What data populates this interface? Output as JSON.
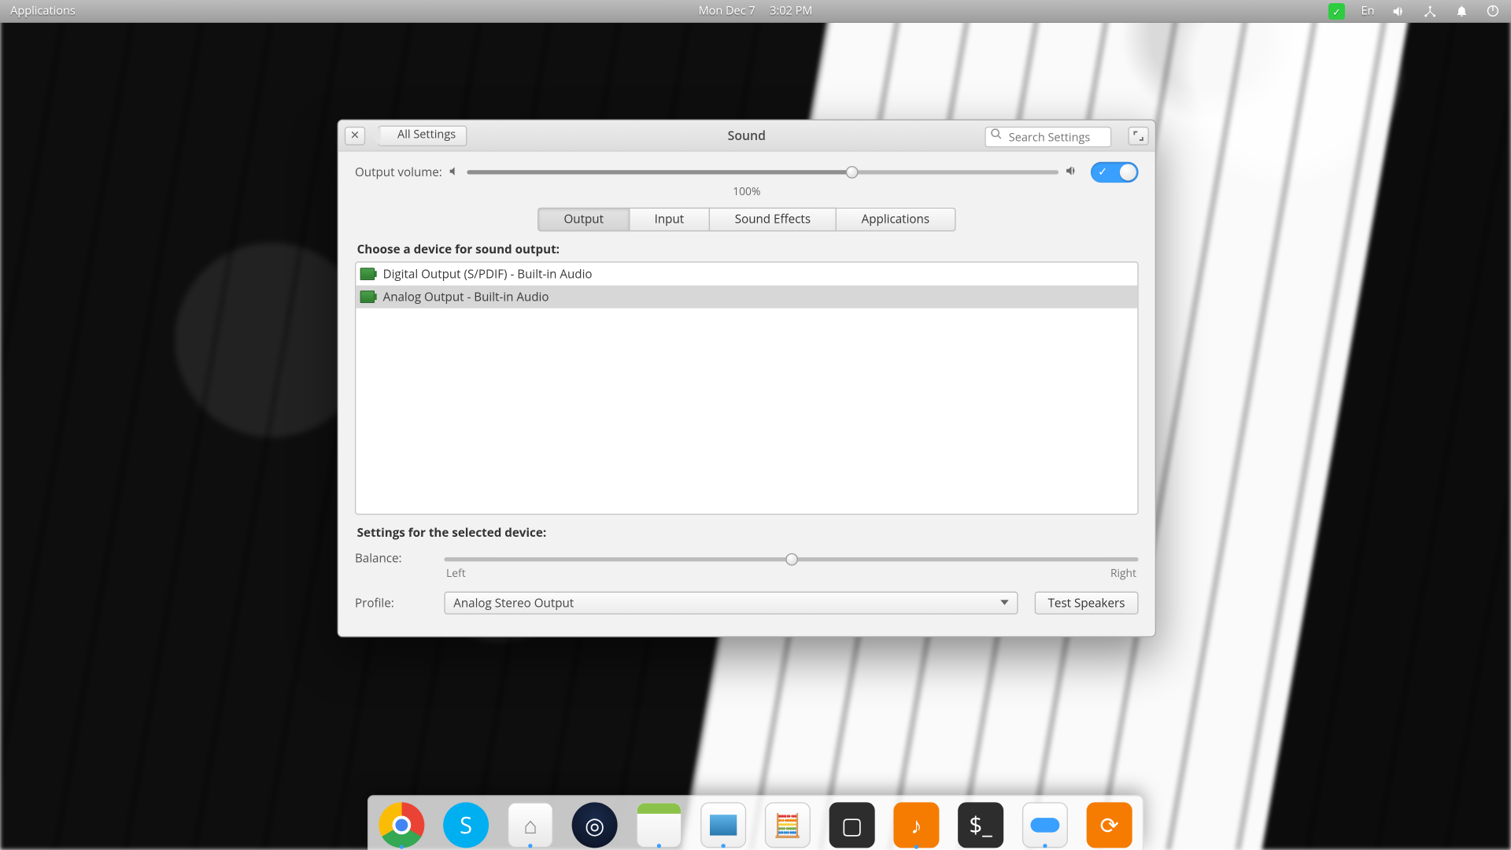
{
  "panel": {
    "applications": "Applications",
    "date": "Mon Dec 7",
    "time": "3:02 PM",
    "lang": "En"
  },
  "window": {
    "title": "Sound",
    "back": "All Settings",
    "search_placeholder": "Search Settings"
  },
  "volume": {
    "label": "Output volume:",
    "percent_text": "100%",
    "percent": 65
  },
  "tabs": {
    "output": "Output",
    "input": "Input",
    "effects": "Sound Effects",
    "apps": "Applications",
    "active": "output"
  },
  "devices": {
    "label": "Choose a device for sound output:",
    "items": [
      {
        "name": "Digital Output (S/PDIF) - Built-in Audio",
        "selected": false
      },
      {
        "name": "Analog Output - Built-in Audio",
        "selected": true
      }
    ]
  },
  "selected": {
    "label": "Settings for the selected device:",
    "balance_label": "Balance:",
    "left": "Left",
    "right": "Right",
    "balance": 50,
    "profile_label": "Profile:",
    "profile_value": "Analog Stereo Output",
    "test": "Test Speakers"
  },
  "dock": {
    "items": [
      "chrome",
      "skype",
      "files",
      "steam",
      "calendar",
      "image-viewer",
      "calculator",
      "screenshot",
      "music",
      "terminal",
      "settings-switch",
      "sync"
    ],
    "running": [
      "chrome",
      "files",
      "calendar",
      "image-viewer",
      "music",
      "settings-switch"
    ]
  }
}
